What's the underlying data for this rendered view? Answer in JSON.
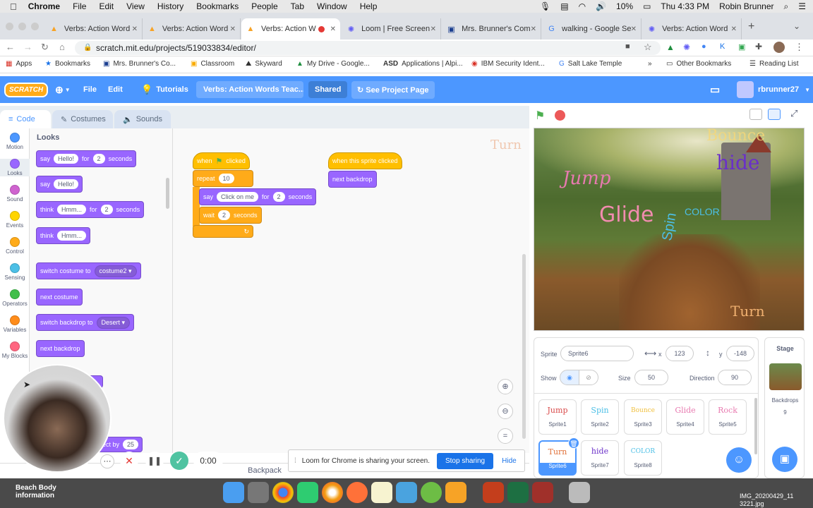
{
  "menubar": {
    "apple": "",
    "app": "Chrome",
    "items": [
      "File",
      "Edit",
      "View",
      "History",
      "Bookmarks",
      "People",
      "Tab",
      "Window",
      "Help"
    ],
    "battery": "10%",
    "clock": "Thu 4:33 PM",
    "user": "Robin Brunner"
  },
  "tabs": [
    {
      "title": "Verbs: Action Word"
    },
    {
      "title": "Verbs: Action Word"
    },
    {
      "title": "Verbs: Action W"
    },
    {
      "title": "Loom | Free Screen"
    },
    {
      "title": "Mrs. Brunner's Com"
    },
    {
      "title": "walking - Google Se"
    },
    {
      "title": "Verbs: Action Word"
    }
  ],
  "address": {
    "url": "scratch.mit.edu/projects/519033834/editor/"
  },
  "bookmarks": [
    "Apps",
    "Bookmarks",
    "Mrs. Brunner's Co...",
    "Classroom",
    "Skyward",
    "My Drive - Google...",
    "Applications | Alpi...",
    "IBM Security Ident...",
    "Salt Lake Temple",
    "»",
    "Other Bookmarks",
    "Reading List"
  ],
  "scratch": {
    "file": "File",
    "edit": "Edit",
    "tutorials": "Tutorials",
    "project_title": "Verbs: Action Words Teac...",
    "shared": "Shared",
    "see_project": "See Project Page",
    "username": "rbrunner27"
  },
  "editor_tabs": {
    "code": "Code",
    "costumes": "Costumes",
    "sounds": "Sounds"
  },
  "categories": [
    {
      "label": "Motion",
      "color": "#4c97ff"
    },
    {
      "label": "Looks",
      "color": "#9966ff"
    },
    {
      "label": "Sound",
      "color": "#cf63cf"
    },
    {
      "label": "Events",
      "color": "#ffd500"
    },
    {
      "label": "Control",
      "color": "#ffab19"
    },
    {
      "label": "Sensing",
      "color": "#4cbfe6"
    },
    {
      "label": "Operators",
      "color": "#40bf4a"
    },
    {
      "label": "Variables",
      "color": "#ff8c1a"
    },
    {
      "label": "My Blocks",
      "color": "#ff6680"
    }
  ],
  "palette": {
    "heading": "Looks",
    "b1": {
      "a": "say",
      "v": "Hello!",
      "b": "for",
      "n": "2",
      "c": "seconds"
    },
    "b2": {
      "a": "say",
      "v": "Hello!"
    },
    "b3": {
      "a": "think",
      "v": "Hmm...",
      "b": "for",
      "n": "2",
      "c": "seconds"
    },
    "b4": {
      "a": "think",
      "v": "Hmm..."
    },
    "b5": {
      "a": "switch costume to",
      "v": "costume2 ▾"
    },
    "b6": {
      "a": "next costume"
    },
    "b7": {
      "a": "switch backdrop to",
      "v": "Desert ▾"
    },
    "b8": {
      "a": "next backdrop"
    },
    "b9": {
      "a": "ect by",
      "n": "25"
    }
  },
  "scripts": {
    "s1": {
      "hat": "when",
      "hat2": "clicked",
      "repeat": "repeat",
      "times": "10",
      "say": "say",
      "msg": "Click on me",
      "for": "for",
      "secs": "2",
      "seconds": "seconds",
      "wait": "wait",
      "wsecs": "2",
      "wseconds": "seconds"
    },
    "s2": {
      "hat": "when this sprite clicked",
      "next": "next backdrop"
    },
    "watermark": "Turn"
  },
  "stage_text": [
    "Jump",
    "hide",
    "Glide",
    "Spin",
    "COLOR",
    "Turn",
    "Bounce"
  ],
  "sprite_info": {
    "sprite_label": "Sprite",
    "sprite_name": "Sprite6",
    "x_label": "x",
    "x": "123",
    "y_label": "y",
    "y": "-148",
    "show": "Show",
    "size_label": "Size",
    "size": "50",
    "direction_label": "Direction",
    "direction": "90"
  },
  "sprites": [
    {
      "thumb": "Jump",
      "name": "Sprite1",
      "color": "#d94a4a"
    },
    {
      "thumb": "Spin",
      "name": "Sprite2",
      "color": "#4cbfe6"
    },
    {
      "thumb": "Bounce",
      "name": "Sprite3",
      "color": "#f0c040"
    },
    {
      "thumb": "Glide",
      "name": "Sprite4",
      "color": "#e87ab0"
    },
    {
      "thumb": "Rock",
      "name": "Sprite5",
      "color": "#e87ab0"
    },
    {
      "thumb": "Turn",
      "name": "Sprite6",
      "color": "#e0713a"
    },
    {
      "thumb": "hide",
      "name": "Sprite7",
      "color": "#6a2fc9"
    },
    {
      "thumb": "COLOR",
      "name": "Sprite8",
      "color": "#4cbfe6"
    }
  ],
  "stage_panel": {
    "title": "Stage",
    "backdrops_label": "Backdrops",
    "backdrops": "9"
  },
  "backpack": "Backpack",
  "loom": {
    "timer": "0:00",
    "message": "Loom for Chrome is sharing your screen.",
    "stop": "Stop sharing",
    "hide": "Hide"
  },
  "desktop": {
    "beach": "Beach Body information",
    "file": "IMG_20200429_11 3221.jpg"
  }
}
